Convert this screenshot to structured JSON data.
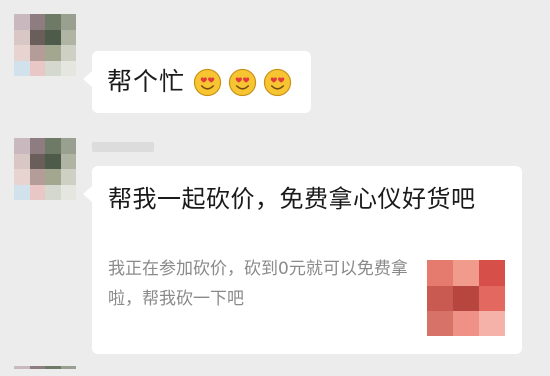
{
  "messages": [
    {
      "text": "帮个忙",
      "emojis": [
        "heart-eyes-emoji",
        "heart-eyes-emoji",
        "heart-eyes-emoji"
      ]
    },
    {
      "card": {
        "title": "帮我一起砍价，免费拿心仪好货吧",
        "description": "我正在参加砍价，砍到0元就可以免费拿啦，帮我砍一下吧"
      }
    }
  ],
  "colors": {
    "background": "#ececec",
    "bubble": "#ffffff",
    "title_text": "#1a1a1a",
    "desc_text": "#8a8a8a",
    "emoji_face": "#f7c531"
  }
}
